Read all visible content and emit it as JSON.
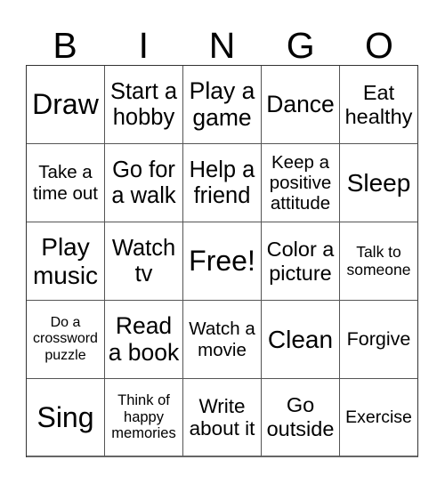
{
  "header": {
    "letters": [
      "B",
      "I",
      "N",
      "G",
      "O"
    ]
  },
  "card": {
    "rows": [
      [
        {
          "text": "Draw"
        },
        {
          "text": "Start a hobby"
        },
        {
          "text": "Play a game"
        },
        {
          "text": "Dance"
        },
        {
          "text": "Eat healthy"
        }
      ],
      [
        {
          "text": "Take a time out"
        },
        {
          "text": "Go for a walk"
        },
        {
          "text": "Help a friend"
        },
        {
          "text": "Keep a positive attitude"
        },
        {
          "text": "Sleep"
        }
      ],
      [
        {
          "text": "Play music"
        },
        {
          "text": "Watch tv"
        },
        {
          "text": "Free!"
        },
        {
          "text": "Color a picture"
        },
        {
          "text": "Talk to someone"
        }
      ],
      [
        {
          "text": "Do a crossword puzzle"
        },
        {
          "text": "Read a book"
        },
        {
          "text": "Watch a movie"
        },
        {
          "text": "Clean"
        },
        {
          "text": "Forgive"
        }
      ],
      [
        {
          "text": "Sing"
        },
        {
          "text": "Think of happy memories"
        },
        {
          "text": "Write about it"
        },
        {
          "text": "Go outside"
        },
        {
          "text": "Exercise"
        }
      ]
    ]
  }
}
